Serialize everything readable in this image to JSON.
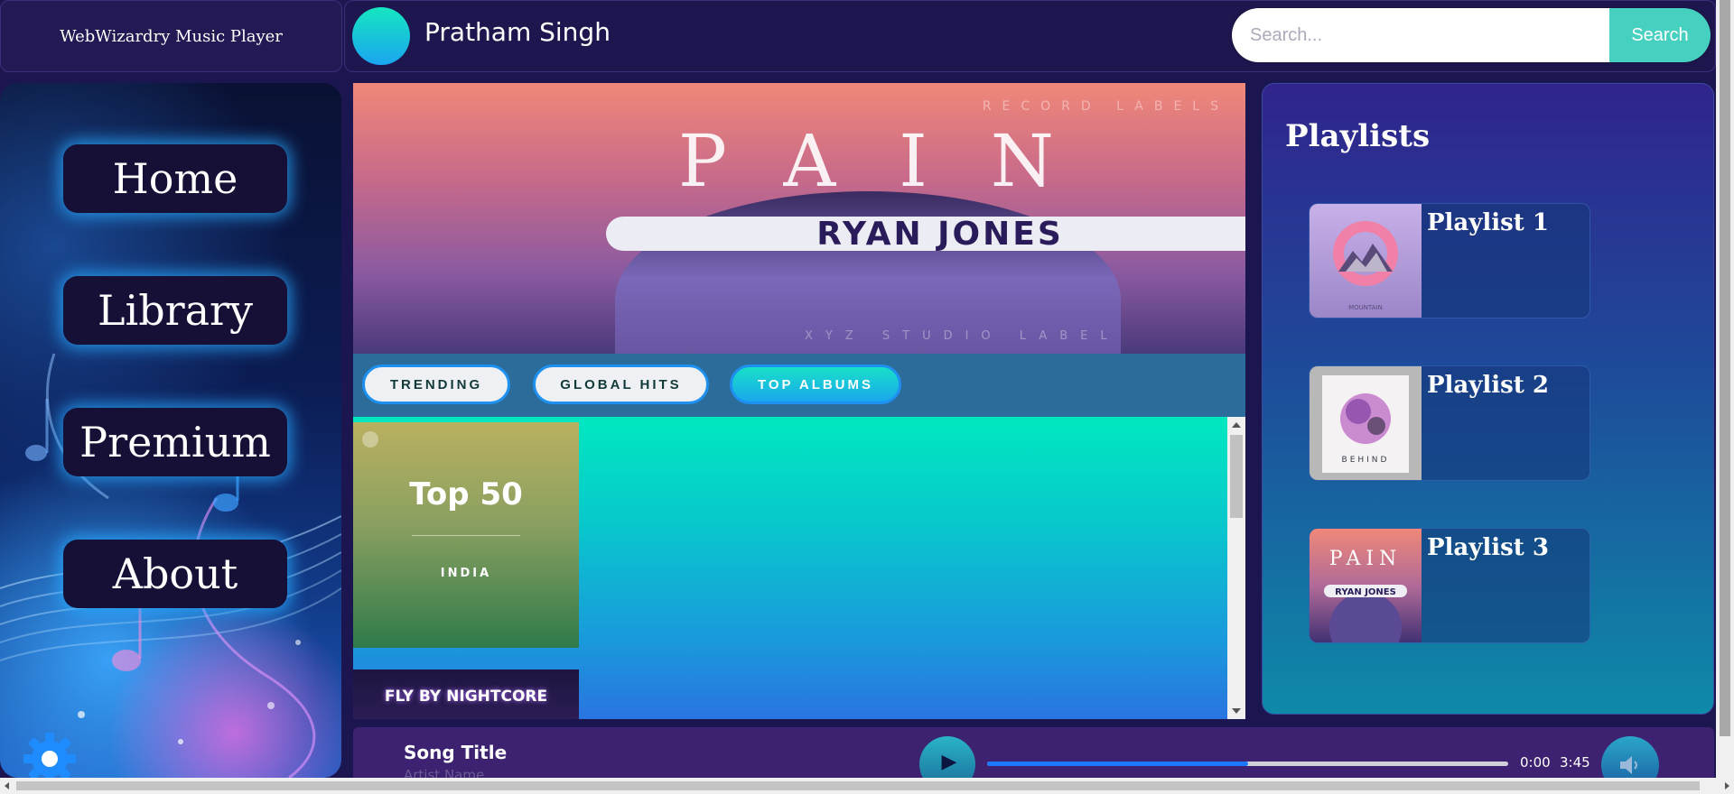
{
  "brand": {
    "title": "WebWizardry Music Player"
  },
  "header": {
    "user_name": "Pratham Singh",
    "search_placeholder": "Search...",
    "search_button": "Search"
  },
  "sidebar": {
    "items": [
      {
        "label": "Home"
      },
      {
        "label": "Library"
      },
      {
        "label": "Premium"
      },
      {
        "label": "About"
      }
    ],
    "settings_icon": "gear-icon"
  },
  "banner": {
    "top_label": "RECORD LABELS",
    "art_title": "PAIN",
    "artist_name": "RYAN JONES",
    "bottom_label": "XYZ STUDIO LABEL"
  },
  "tabs": [
    {
      "label": "TRENDING",
      "active": false
    },
    {
      "label": "GLOBAL HITS",
      "active": false
    },
    {
      "label": "TOP ALBUMS",
      "active": true
    }
  ],
  "cards": [
    {
      "title": "Top 50",
      "subtitle": "INDIA"
    },
    {
      "title": "FLY BY NIGHTCORE"
    }
  ],
  "playlists": {
    "title": "Playlists",
    "items": [
      {
        "name": "Playlist 1",
        "art_text": "MOUNTAIN"
      },
      {
        "name": "Playlist 2",
        "art_text": "BEHIND"
      },
      {
        "name": "Playlist 3",
        "art_title": "PAIN",
        "art_artist": "RYAN JONES"
      }
    ]
  },
  "player": {
    "song_title": "Song Title",
    "artist": "Artist Name",
    "current_time": "0:00",
    "total_time": "3:45",
    "progress_fraction": 0.5
  },
  "colors": {
    "accent": "#1e78ff",
    "tab_active": "#18e0c8",
    "panel": "#1e174f"
  }
}
